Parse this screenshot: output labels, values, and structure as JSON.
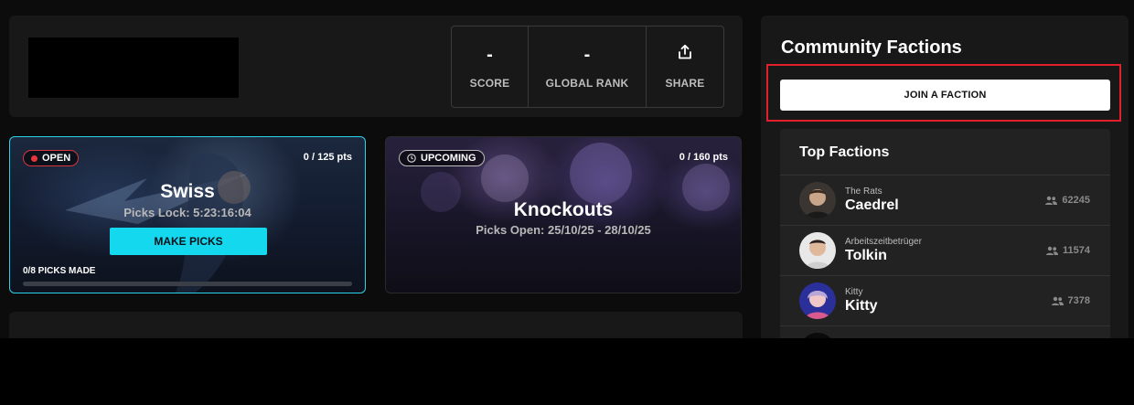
{
  "stats": {
    "score_value": "-",
    "score_label": "SCORE",
    "rank_value": "-",
    "rank_label": "GLOBAL RANK",
    "share_label": "SHARE"
  },
  "stages": [
    {
      "status": "OPEN",
      "points": "0 / 125 pts",
      "title": "Swiss",
      "subtitle": "Picks Lock: 5:23:16:04",
      "button_label": "MAKE PICKS",
      "picks_made": "0/8 PICKS MADE",
      "progress": 0
    },
    {
      "status": "UPCOMING",
      "points": "0 / 160 pts",
      "title": "Knockouts",
      "subtitle": "Picks Open: 25/10/25 - 28/10/25"
    }
  ],
  "community": {
    "title": "Community Factions",
    "join_label": "JOIN A FACTION",
    "top_title": "Top Factions",
    "factions": [
      {
        "faction": "The Rats",
        "name": "Caedrel",
        "members": "62245"
      },
      {
        "faction": "Arbeitszeitbetrüger",
        "name": "Tolkin",
        "members": "11574"
      },
      {
        "faction": "Kitty",
        "name": "Kitty",
        "members": "7378"
      }
    ]
  },
  "colors": {
    "accent": "#14d8ee",
    "open_red": "#e8343c",
    "highlight_red": "#e0202a"
  }
}
